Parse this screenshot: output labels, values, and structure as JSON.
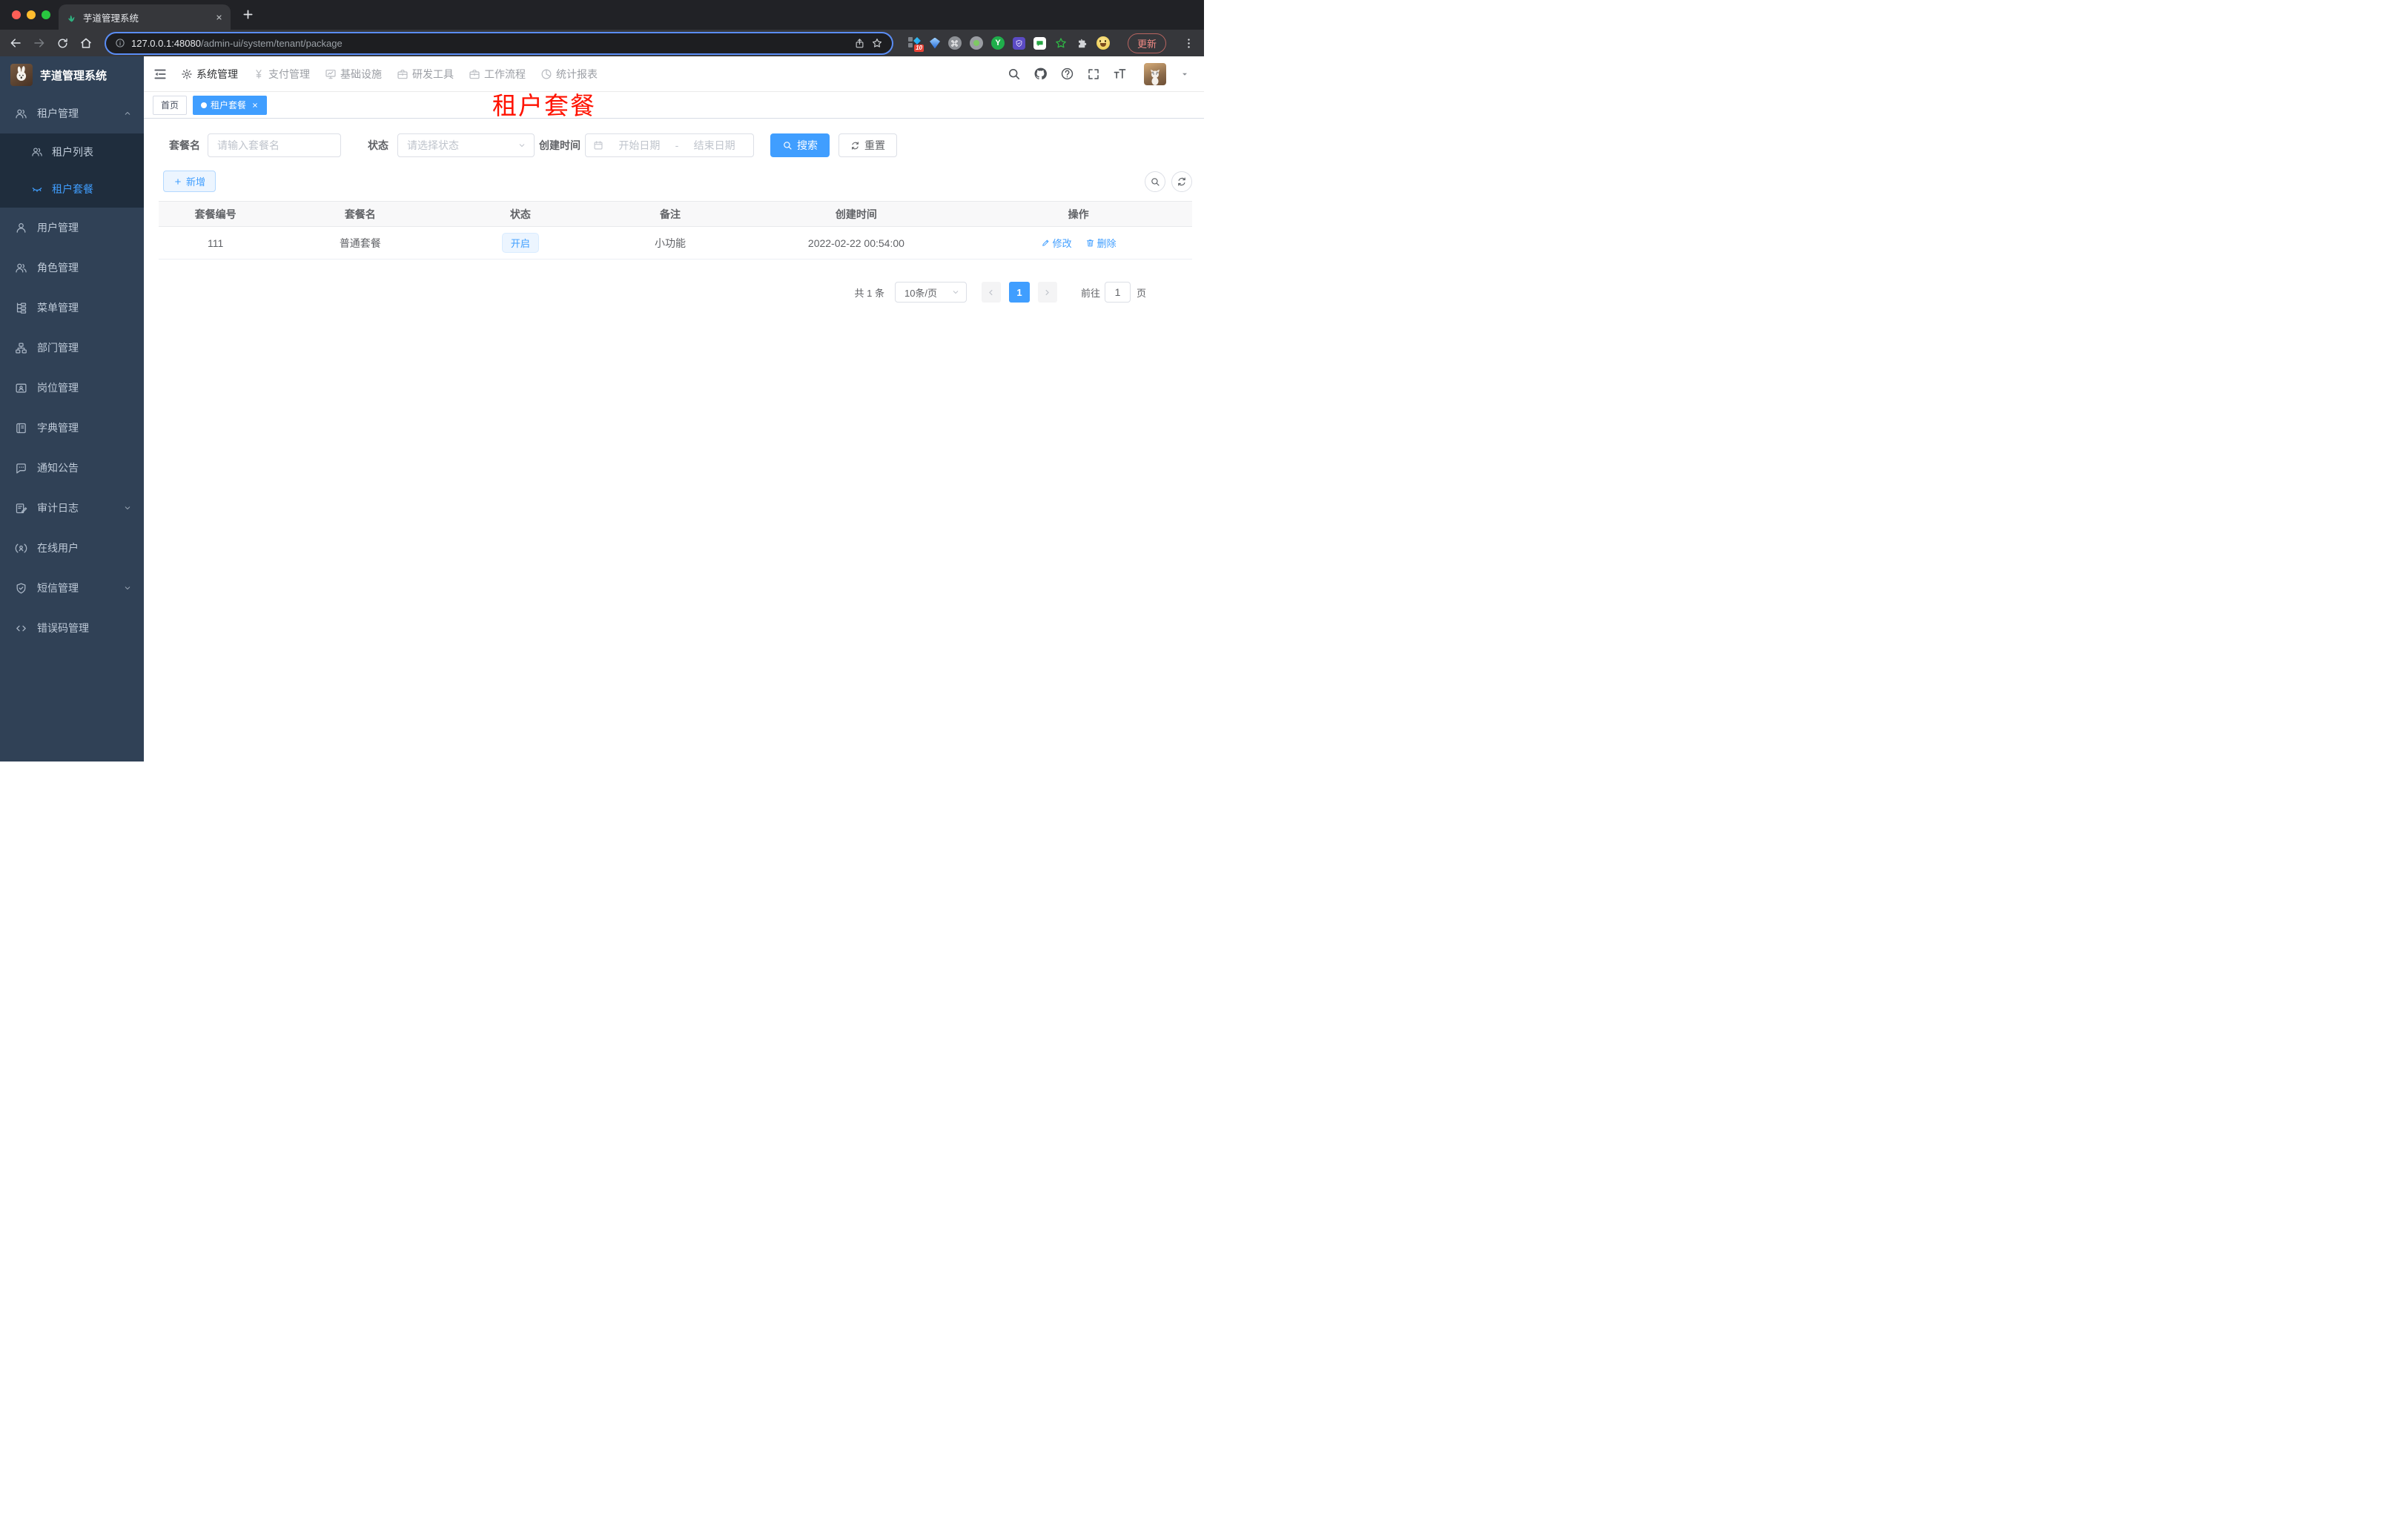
{
  "colors": {
    "accent": "#409eff",
    "sidebar_bg": "#304156",
    "submenu_bg": "#1f2d3d",
    "annotation_red": "#ff1200",
    "tag_bg": "#ecf5ff"
  },
  "browser": {
    "tab_title": "芋道管理系统",
    "url_host": "127.0.0.1:48080",
    "url_path": "/admin-ui/system/tenant/package",
    "update_label": "更新",
    "ext_badge": "10",
    "ext_y_label": "Y"
  },
  "sidebar": {
    "logo_title": "芋道管理系统",
    "group_tenant": "租户管理",
    "tenant_list": "租户列表",
    "tenant_package": "租户套餐",
    "items": [
      "用户管理",
      "角色管理",
      "菜单管理",
      "部门管理",
      "岗位管理",
      "字典管理",
      "通知公告",
      "审计日志",
      "在线用户",
      "短信管理",
      "错误码管理"
    ]
  },
  "topnav": {
    "items": [
      "系统管理",
      "支付管理",
      "基础设施",
      "研发工具",
      "工作流程",
      "统计报表"
    ]
  },
  "tags": {
    "home": "首页",
    "active": "租户套餐"
  },
  "annotation": {
    "text": "租户套餐"
  },
  "filters": {
    "name_label": "套餐名",
    "name_placeholder": "请输入套餐名",
    "status_label": "状态",
    "status_placeholder": "请选择状态",
    "date_label": "创建时间",
    "date_start": "开始日期",
    "date_separator": "-",
    "date_end": "结束日期",
    "search_label": "搜索",
    "reset_label": "重置",
    "add_label": "新增"
  },
  "table": {
    "headers": [
      "套餐编号",
      "套餐名",
      "状态",
      "备注",
      "创建时间",
      "操作"
    ],
    "rows": [
      {
        "id": "111",
        "name": "普通套餐",
        "status": "开启",
        "remark": "小功能",
        "created_at": "2022-02-22 00:54:00",
        "action_edit": "修改",
        "action_delete": "删除"
      }
    ]
  },
  "pagination": {
    "total": "共 1 条",
    "page_size": "10条/页",
    "page": "1",
    "goto_label": "前往",
    "goto_value": "1",
    "page_unit": "页"
  }
}
